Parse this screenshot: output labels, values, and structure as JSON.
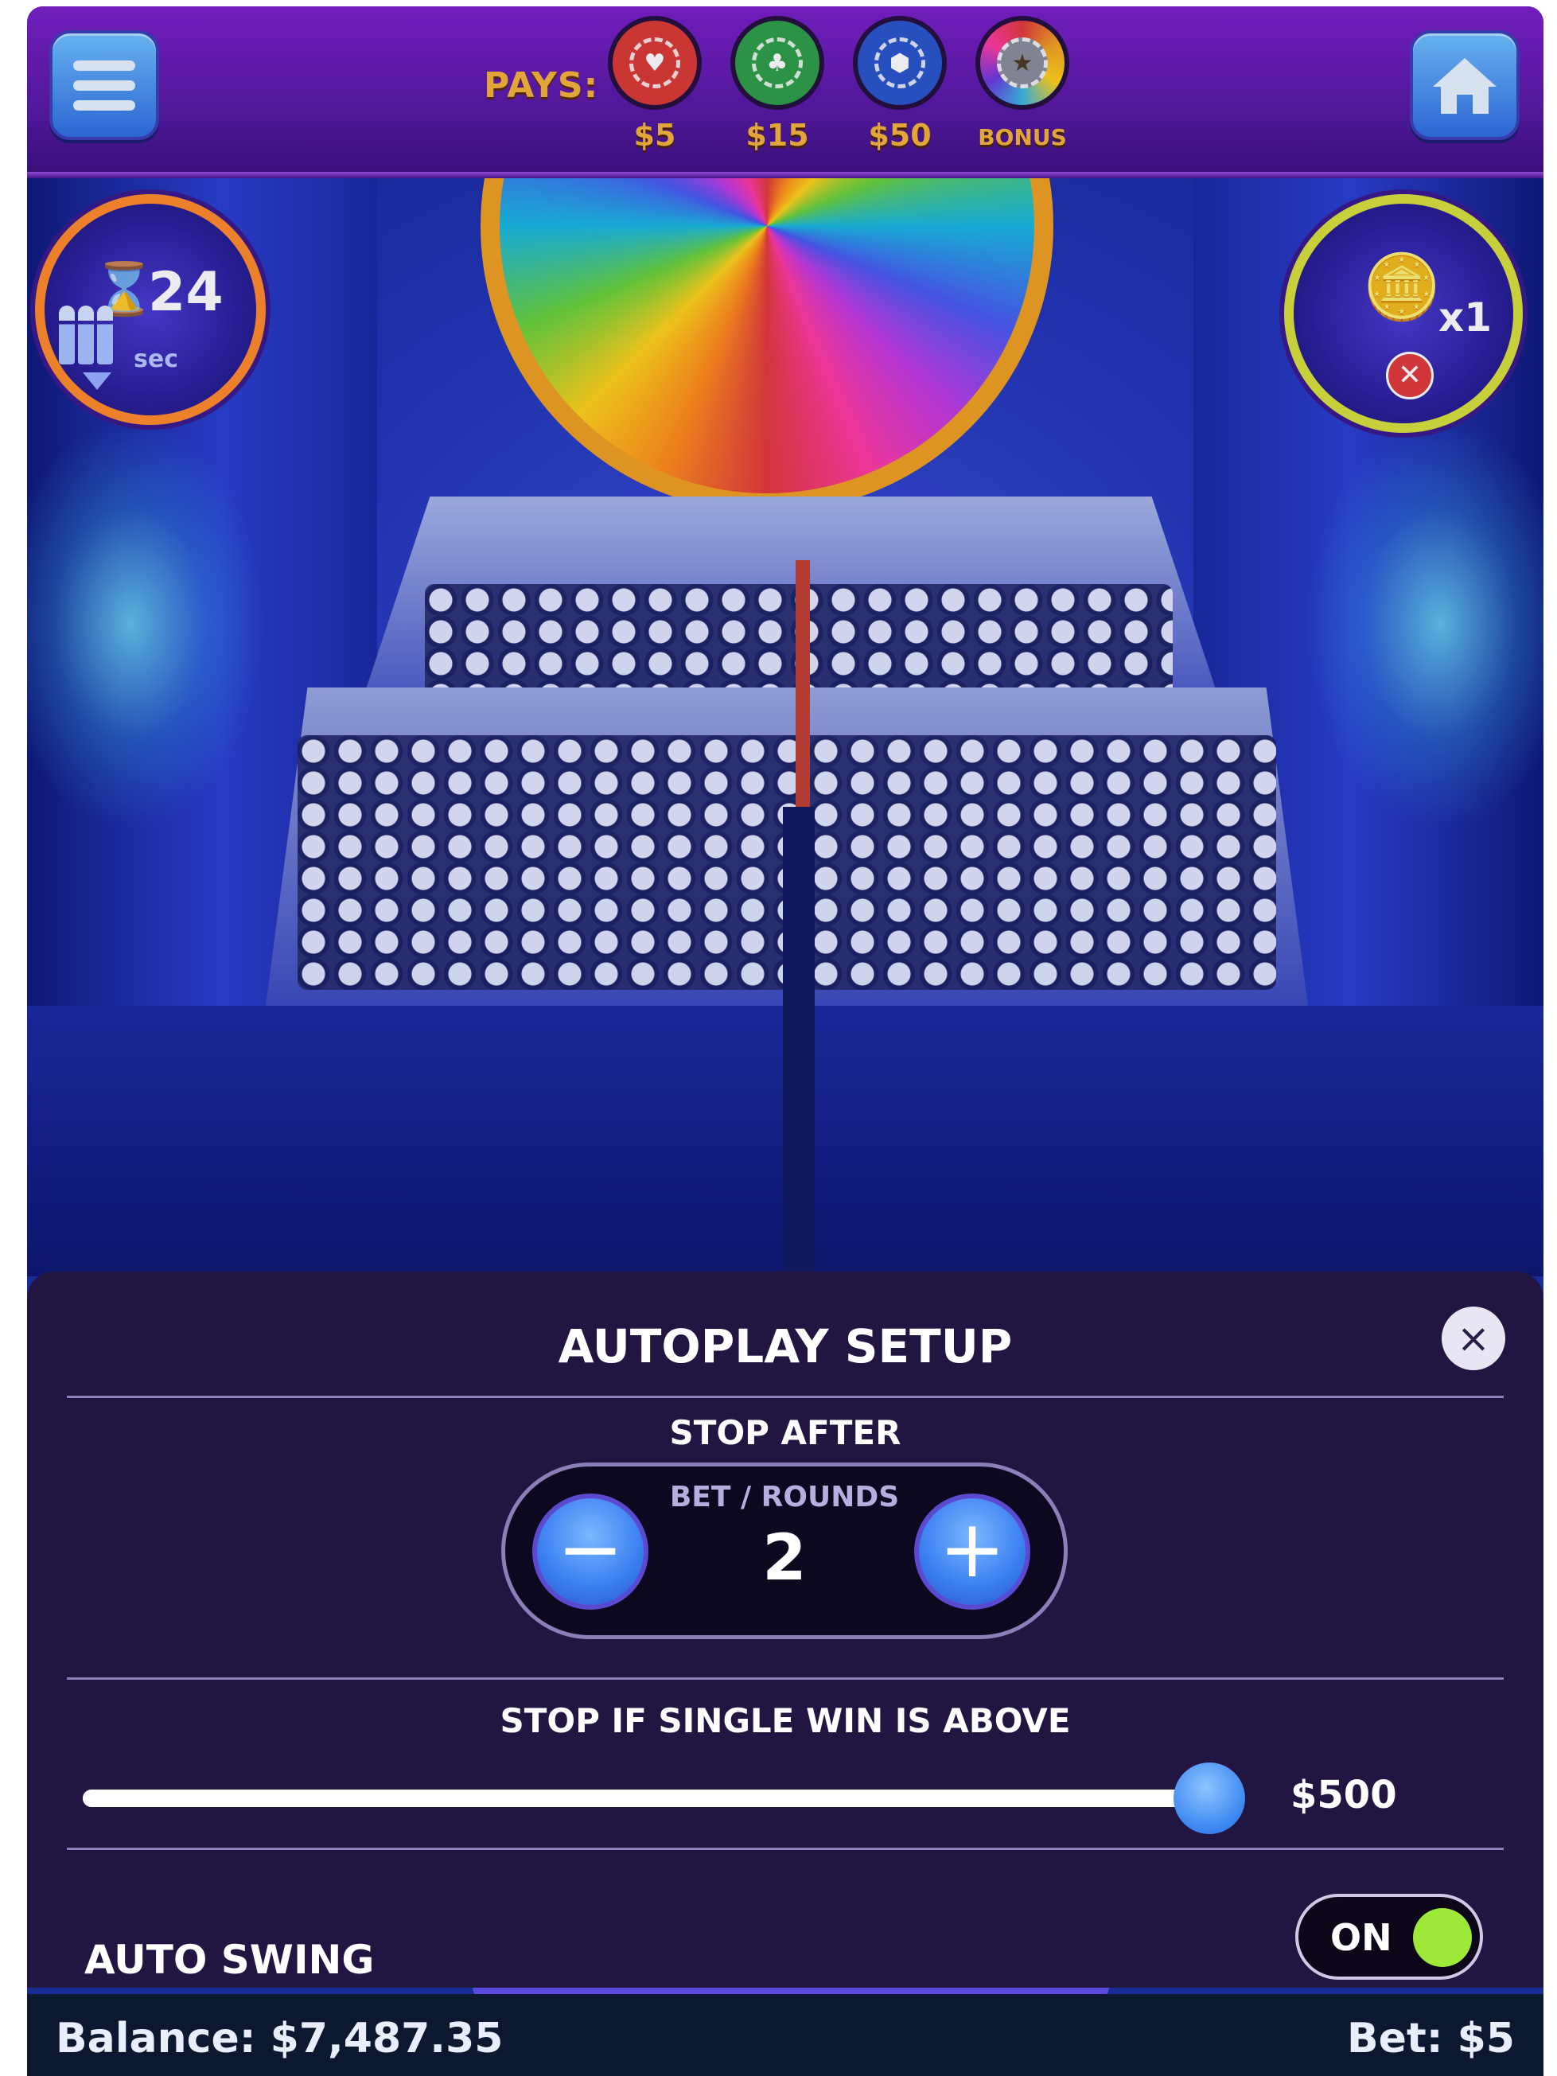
{
  "header": {
    "pays_label": "PAYS:",
    "chips": [
      {
        "value": "$5",
        "color": "#d93a34",
        "icon": "heart-icon",
        "glyph": "♥"
      },
      {
        "value": "$15",
        "color": "#2f9e46",
        "icon": "club-icon",
        "glyph": "♣"
      },
      {
        "value": "$50",
        "color": "#2a55c8",
        "icon": "hexagon-icon",
        "glyph": "⬢"
      },
      {
        "value": "BONUS",
        "color": "#8a8f9a",
        "icon": "star-icon",
        "glyph": "★"
      }
    ],
    "menu_icon": "hamburger-menu-icon",
    "home_icon": "home-icon"
  },
  "hud": {
    "timer_value": "24",
    "timer_unit": "sec",
    "multiplier": "x1"
  },
  "autoplay": {
    "title": "AUTOPLAY SETUP",
    "stop_after_label": "STOP AFTER",
    "stepper_caption": "BET / ROUNDS",
    "stepper_value": "2",
    "single_win_label": "STOP IF SINGLE WIN IS ABOVE",
    "single_win_value": "$500",
    "single_win_slider_fraction": 0.97,
    "auto_swing_label": "AUTO SWING",
    "auto_swing_state": "ON"
  },
  "status": {
    "balance": "Balance: $7,487.35",
    "bet": "Bet: $5"
  },
  "colors": {
    "accent": "#3a86f0",
    "panel": "#221542",
    "toggle_on": "#9ee83a",
    "gold": "#f4b23a"
  }
}
